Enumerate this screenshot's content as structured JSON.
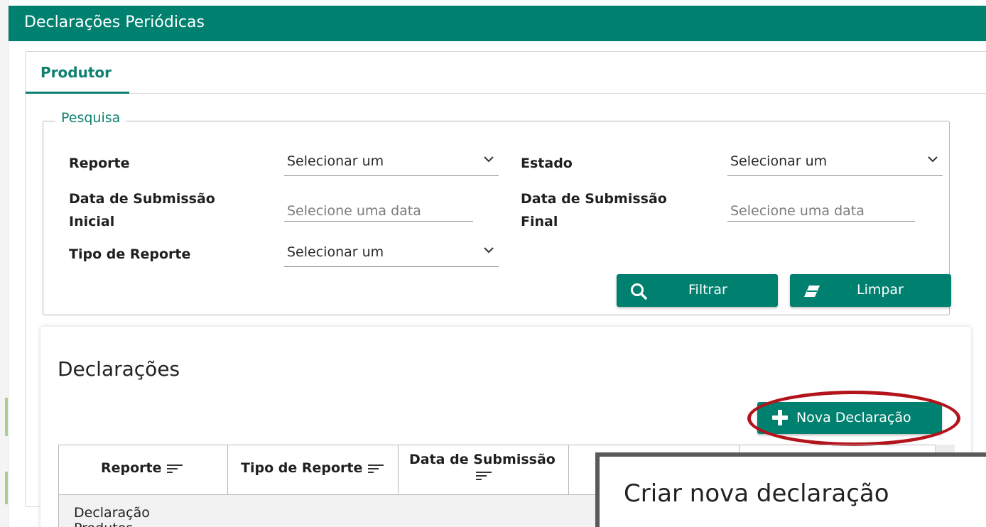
{
  "window": {
    "title": "Declarações Periódicas"
  },
  "tabs": [
    {
      "label": "Produtor",
      "active": true
    }
  ],
  "search": {
    "legend": "Pesquisa",
    "fields": {
      "reporte": {
        "label": "Reporte",
        "value": "Selecionar um"
      },
      "estado": {
        "label": "Estado",
        "value": "Selecionar um"
      },
      "data_inicial": {
        "label_line1": "Data de Submissão",
        "label_line2": "Inicial",
        "placeholder": "Selecione uma data"
      },
      "data_final": {
        "label_line1": "Data de Submissão",
        "label_line2": "Final",
        "placeholder": "Selecione uma data"
      },
      "tipo_reporte": {
        "label": "Tipo de Reporte",
        "value": "Selecionar um"
      }
    },
    "buttons": {
      "filter": "Filtrar",
      "clear": "Limpar"
    }
  },
  "declaracoes": {
    "title": "Declarações",
    "new_button": "Nova Declaração",
    "columns": [
      "Reporte",
      "Tipo de Reporte",
      "Data de Submissão"
    ],
    "rows": [
      {
        "reporte_line1": "Declaração",
        "reporte_line2": "Produtos"
      }
    ]
  },
  "dialog": {
    "title": "Criar nova declaração"
  },
  "colors": {
    "primary": "#00806f",
    "highlight": "#b3141b"
  },
  "icons": {
    "filter": "search-icon",
    "clear": "eraser-icon",
    "new": "plus-icon",
    "sort": "sort-icon",
    "select": "chevron-down-icon"
  }
}
